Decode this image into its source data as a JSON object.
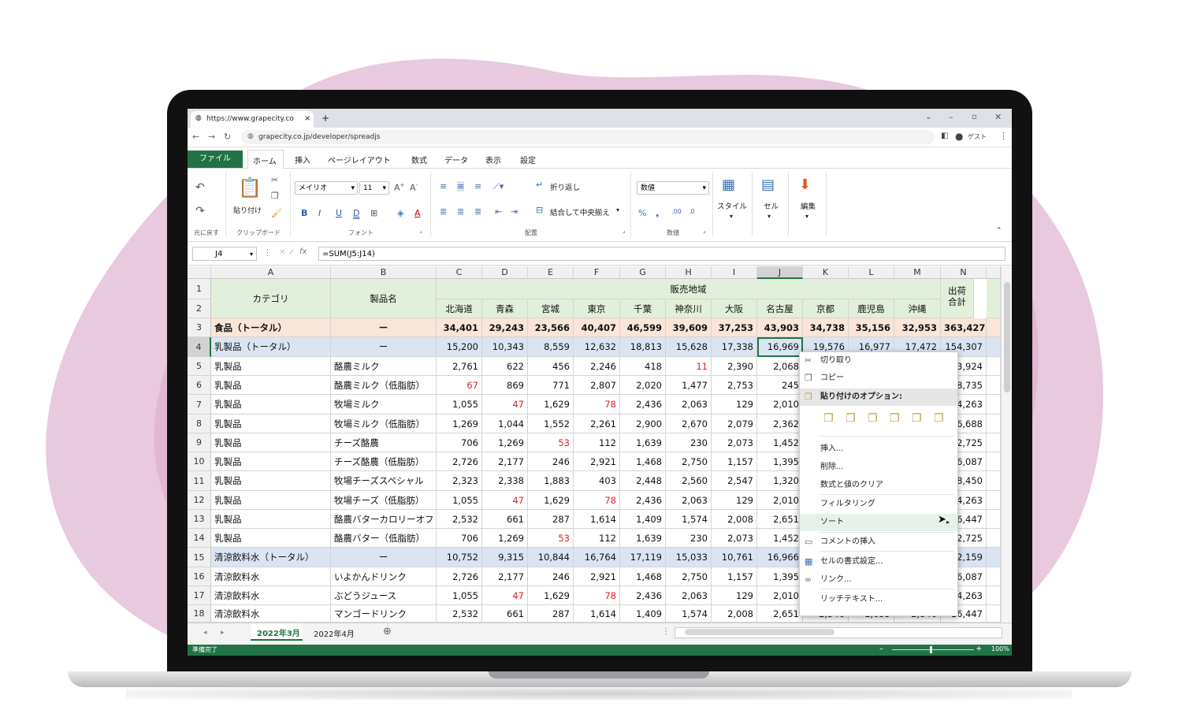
{
  "browser": {
    "tab_title": "https://www.grapecity.co",
    "tab_close": "×",
    "new_tab": "+",
    "url": "grapecity.co.jp/developer/spreadjs",
    "user": "ゲスト"
  },
  "menu": {
    "tabs": [
      "ファイル",
      "ホーム",
      "挿入",
      "ページレイアウト",
      "数式",
      "データ",
      "表示",
      "設定"
    ]
  },
  "ribbon": {
    "undo_group": "元に戻す",
    "paste_label": "貼り付け",
    "clipboard_group": "クリップボード",
    "font_name": "メイリオ",
    "font_size": "11",
    "font_group": "フォント",
    "wrap_text": "折り返し",
    "merge_center": "結合して中央揃え",
    "alignment_group": "配置",
    "number_format": "数値",
    "number_group": "数値",
    "style_label": "スタイル",
    "cell_label": "セル",
    "edit_label": "編集"
  },
  "formula_bar": {
    "name_box": "J4",
    "formula": "=SUM(J5:J14)"
  },
  "grid": {
    "columns": [
      "A",
      "B",
      "C",
      "D",
      "E",
      "F",
      "G",
      "H",
      "I",
      "J",
      "K",
      "L",
      "M",
      "N"
    ],
    "header_category": "カテゴリ",
    "header_product": "製品名",
    "header_region": "販売地域",
    "header_total": "出荷合計",
    "regions": [
      "北海道",
      "青森",
      "宮城",
      "東京",
      "千葉",
      "神奈川",
      "大阪",
      "名古屋",
      "京都",
      "鹿児島",
      "沖縄"
    ],
    "rows": [
      {
        "n": "3",
        "cat": "食品（トータル）",
        "prod": "ー",
        "vals": [
          "34,401",
          "29,243",
          "23,566",
          "40,407",
          "46,599",
          "39,609",
          "37,253",
          "43,903",
          "34,738",
          "35,156",
          "32,953",
          "363,427"
        ],
        "red": []
      },
      {
        "n": "4",
        "cat": "乳製品（トータル）",
        "prod": "ー",
        "vals": [
          "15,200",
          "10,343",
          "8,559",
          "12,632",
          "18,813",
          "15,628",
          "17,338",
          "16,969",
          "19,576",
          "16,977",
          "17,472",
          "154,307"
        ],
        "red": []
      },
      {
        "n": "5",
        "cat": "乳製品",
        "prod": "酪農ミルク",
        "vals": [
          "2,761",
          "622",
          "456",
          "2,246",
          "418",
          "11",
          "2,390",
          "2,068",
          "",
          "",
          "",
          "13,924"
        ],
        "red": [
          5
        ]
      },
      {
        "n": "6",
        "cat": "乳製品",
        "prod": "酪農ミルク（低脂肪）",
        "vals": [
          "67",
          "869",
          "771",
          "2,807",
          "2,020",
          "1,477",
          "2,753",
          "245",
          "",
          "",
          "",
          "18,735"
        ],
        "red": [
          0
        ]
      },
      {
        "n": "7",
        "cat": "乳製品",
        "prod": "牧場ミルク",
        "vals": [
          "1,055",
          "47",
          "1,629",
          "78",
          "2,436",
          "2,063",
          "129",
          "2,010",
          "",
          "",
          "",
          "14,263"
        ],
        "red": [
          1,
          3
        ]
      },
      {
        "n": "8",
        "cat": "乳製品",
        "prod": "牧場ミルク（低脂肪）",
        "vals": [
          "1,269",
          "1,044",
          "1,552",
          "2,261",
          "2,900",
          "2,670",
          "2,079",
          "2,362",
          "",
          "",
          "",
          "16,688"
        ],
        "red": []
      },
      {
        "n": "9",
        "cat": "乳製品",
        "prod": "チーズ酪農",
        "vals": [
          "706",
          "1,269",
          "53",
          "112",
          "1,639",
          "230",
          "2,073",
          "1,452",
          "",
          "",
          "",
          "12,725"
        ],
        "red": [
          2
        ]
      },
      {
        "n": "10",
        "cat": "乳製品",
        "prod": "チーズ酪農（低脂肪）",
        "vals": [
          "2,726",
          "2,177",
          "246",
          "2,921",
          "1,468",
          "2,750",
          "1,157",
          "1,395",
          "",
          "",
          "",
          "16,087"
        ],
        "red": []
      },
      {
        "n": "11",
        "cat": "乳製品",
        "prod": "牧場チーズスペシャル",
        "vals": [
          "2,323",
          "2,338",
          "1,883",
          "403",
          "2,448",
          "2,560",
          "2,547",
          "1,320",
          "",
          "",
          "",
          "18,450"
        ],
        "red": []
      },
      {
        "n": "12",
        "cat": "乳製品",
        "prod": "牧場チーズ（低脂肪）",
        "vals": [
          "1,055",
          "47",
          "1,629",
          "78",
          "2,436",
          "2,063",
          "129",
          "2,010",
          "",
          "",
          "",
          "14,263"
        ],
        "red": [
          1,
          3
        ]
      },
      {
        "n": "13",
        "cat": "乳製品",
        "prod": "酪農バターカロリーオフ",
        "vals": [
          "2,532",
          "661",
          "287",
          "1,614",
          "1,409",
          "1,574",
          "2,008",
          "2,651",
          "",
          "",
          "",
          "16,447"
        ],
        "red": []
      },
      {
        "n": "14",
        "cat": "乳製品",
        "prod": "酪農バター（低脂肪）",
        "vals": [
          "706",
          "1,269",
          "53",
          "112",
          "1,639",
          "230",
          "2,073",
          "1,452",
          "",
          "",
          "",
          "12,725"
        ],
        "red": [
          2
        ]
      },
      {
        "n": "15",
        "cat": "清涼飲料水（トータル）",
        "prod": "ー",
        "vals": [
          "10,752",
          "9,315",
          "10,844",
          "16,764",
          "17,119",
          "15,033",
          "10,761",
          "16,966",
          "",
          "",
          "",
          "22,159"
        ],
        "red": []
      },
      {
        "n": "16",
        "cat": "清涼飲料水",
        "prod": "いよかんドリンク",
        "vals": [
          "2,726",
          "2,177",
          "246",
          "2,921",
          "1,468",
          "2,750",
          "1,157",
          "1,395",
          "",
          "",
          "",
          "16,087"
        ],
        "red": []
      },
      {
        "n": "17",
        "cat": "清涼飲料水",
        "prod": "ぶどうジュース",
        "vals": [
          "1,055",
          "47",
          "1,629",
          "78",
          "2,436",
          "2,063",
          "129",
          "2,010",
          "",
          "",
          "",
          "14,263"
        ],
        "red": [
          1,
          3
        ]
      },
      {
        "n": "18",
        "cat": "清涼飲料水",
        "prod": "マンゴードリンク",
        "vals": [
          "2,532",
          "661",
          "287",
          "1,614",
          "1,409",
          "1,574",
          "2,008",
          "2,651",
          "2,546",
          "1,655",
          "2,846",
          "16,447"
        ],
        "red": []
      }
    ]
  },
  "context_menu": {
    "cut": "切り取り",
    "copy": "コピー",
    "paste_options": "貼り付けのオプション:",
    "insert": "挿入...",
    "delete": "削除...",
    "clear": "数式と値のクリア",
    "filter": "フィルタリング",
    "sort": "ソート",
    "insert_comment": "コメントの挿入",
    "format_cells": "セルの書式設定...",
    "link": "リンク...",
    "rich_text": "リッチテキスト..."
  },
  "sheets": {
    "tabs": [
      "2022年3月",
      "2022年4月"
    ],
    "active": "2022年3月"
  },
  "status": {
    "ready": "準備完了",
    "zoom": "100%"
  },
  "colors": {
    "brand_green": "#217346",
    "total_row": "#fbe5d6",
    "subtotal_row": "#dbe5f1",
    "header_green": "#e2efda"
  }
}
